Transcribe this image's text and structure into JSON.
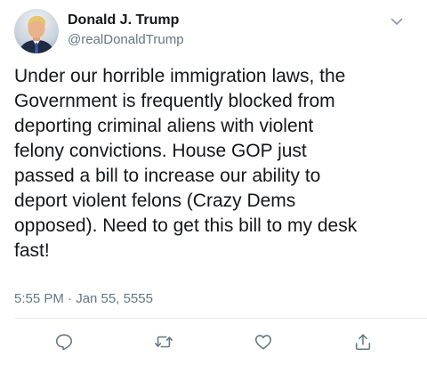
{
  "author": {
    "display_name": "Donald J. Trump",
    "handle": "@realDonaldTrump"
  },
  "tweet": {
    "text": "Under our horrible immigration laws, the\nGovernment is frequently blocked from\ndeporting criminal aliens with violent\nfelony convictions. House GOP just\npassed a bill to increase our ability to\ndeport violent felons (Crazy Dems\nopposed). Need to get this bill to my desk\nfast!",
    "timestamp": "5:55 PM · Jan 55, 5555"
  },
  "icons": {
    "menu": "chevron-down-icon",
    "reply": "reply-icon",
    "retweet": "retweet-icon",
    "like": "heart-icon",
    "share": "share-icon"
  },
  "colors": {
    "primary_text": "#14171a",
    "secondary_text": "#657786",
    "icon": "#657786",
    "divider": "#e6ecf0"
  }
}
